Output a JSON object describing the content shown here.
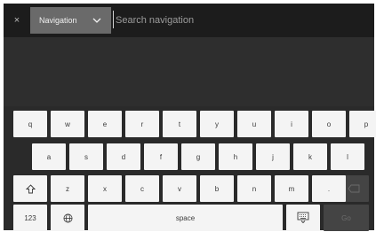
{
  "top_bar": {
    "close_glyph": "×",
    "mode_label": "Navigation",
    "search_placeholder": "Search navigation"
  },
  "keyboard": {
    "row1": [
      "q",
      "w",
      "e",
      "r",
      "t",
      "y",
      "u",
      "i",
      "o",
      "p"
    ],
    "row2": [
      "a",
      "s",
      "d",
      "f",
      "g",
      "h",
      "j",
      "k",
      "l"
    ],
    "row3": [
      "z",
      "x",
      "c",
      "v",
      "b",
      "n",
      "m",
      "."
    ],
    "numbers_label": "123",
    "space_label": "space",
    "go_label": "Go",
    "icons": {
      "shift": "shift-icon",
      "backspace": "backspace-icon",
      "language": "globe-icon",
      "hide_keyboard": "keyboard-hide-icon"
    }
  },
  "colors": {
    "key_background": "#f4f4f4",
    "key_text": "#3a3a3a",
    "keyboard_background": "#2a2a2a",
    "disabled_key": "#444444"
  }
}
